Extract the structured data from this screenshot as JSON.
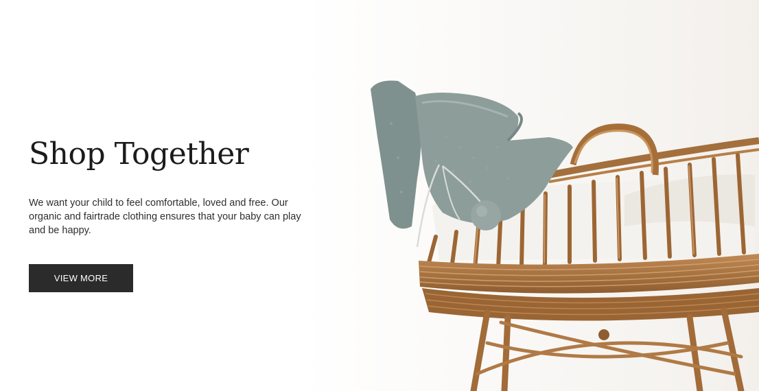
{
  "hero": {
    "title": "Shop Together",
    "description": "We want your child to feel comfortable, loved and free. Our organic and fairtrade clothing ensures that your baby can play and be happy.",
    "cta_label": "VIEW MORE",
    "image_alt": "Wicker baby bassinet with knitted bonnets"
  },
  "colors": {
    "background": "#ffffff",
    "button": "#2b2b2b",
    "button_text": "#ffffff",
    "wicker": "#b07a45",
    "knit": "#8b9b98"
  }
}
